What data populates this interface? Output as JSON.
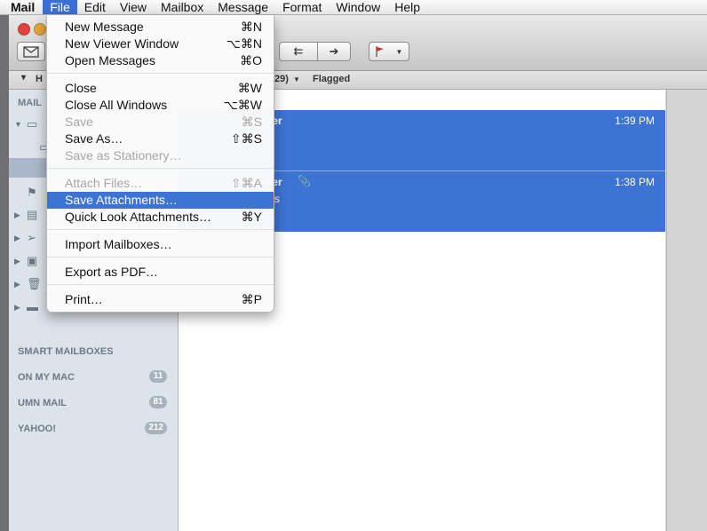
{
  "menubar": {
    "app": "Mail",
    "items": [
      "File",
      "Edit",
      "View",
      "Mailbox",
      "Message",
      "Format",
      "Window",
      "Help"
    ]
  },
  "favorites_bar": {
    "count_fragment": "29)",
    "flagged": "Flagged"
  },
  "sidebar": {
    "header_mailboxes": "MAIL",
    "sections": [
      {
        "label": "SMART MAILBOXES",
        "badge": ""
      },
      {
        "label": "ON MY MAC",
        "badge": "11"
      },
      {
        "label": "UMN MAIL",
        "badge": "81"
      },
      {
        "label": "YAHOO!",
        "badge": "212"
      }
    ]
  },
  "messages": [
    {
      "from_fragment": "der",
      "time": "1:39 PM",
      "preview_fragment": ""
    },
    {
      "from_fragment": "der",
      "time": "1:38 PM",
      "preview_fragment": "s"
    }
  ],
  "file_menu": {
    "items": [
      {
        "label": "New Message",
        "shortcut": "⌘N",
        "enabled": true
      },
      {
        "label": "New Viewer Window",
        "shortcut": "⌥⌘N",
        "enabled": true
      },
      {
        "label": "Open Messages",
        "shortcut": "⌘O",
        "enabled": true
      },
      {
        "label": "Close",
        "shortcut": "⌘W",
        "enabled": true
      },
      {
        "label": "Close All Windows",
        "shortcut": "⌥⌘W",
        "enabled": true
      },
      {
        "label": "Save",
        "shortcut": "⌘S",
        "enabled": false
      },
      {
        "label": "Save As…",
        "shortcut": "⇧⌘S",
        "enabled": true
      },
      {
        "label": "Save as Stationery…",
        "shortcut": "",
        "enabled": false
      },
      {
        "label": "Attach Files…",
        "shortcut": "⇧⌘A",
        "enabled": false
      },
      {
        "label": "Save Attachments…",
        "shortcut": "",
        "enabled": true,
        "highlighted": true
      },
      {
        "label": "Quick Look Attachments…",
        "shortcut": "⌘Y",
        "enabled": true
      },
      {
        "label": "Import Mailboxes…",
        "shortcut": "",
        "enabled": true
      },
      {
        "label": "Export as PDF…",
        "shortcut": "",
        "enabled": true
      },
      {
        "label": "Print…",
        "shortcut": "⌘P",
        "enabled": true
      }
    ]
  },
  "colors": {
    "selection": "#3d73d2",
    "menu_highlight": "#3b6fd6",
    "sidebar_bg": "#dde3ea"
  }
}
